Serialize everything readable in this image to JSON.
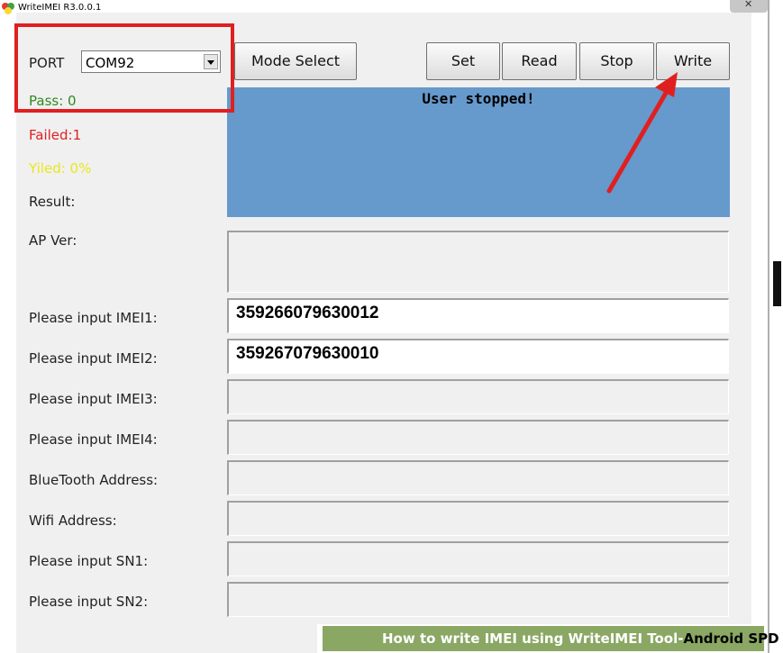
{
  "window": {
    "title": "WriteIMEI R3.0.0.1"
  },
  "port": {
    "label": "PORT",
    "value": "COM92"
  },
  "toolbar": {
    "mode_select": "Mode Select",
    "set": "Set",
    "read": "Read",
    "stop": "Stop",
    "write": "Write"
  },
  "stats": {
    "pass": "Pass:  0",
    "failed": "Failed:1",
    "yield": "Yiled: 0%",
    "result": "Result:"
  },
  "status_message": "User stopped!",
  "fields": [
    {
      "label": "AP Ver:",
      "value": ""
    },
    {
      "label": "Please input IMEI1:",
      "value": "359266079630012"
    },
    {
      "label": "Please input IMEI2:",
      "value": "359267079630010"
    },
    {
      "label": "Please input IMEI3:",
      "value": ""
    },
    {
      "label": "Please input IMEI4:",
      "value": ""
    },
    {
      "label": "BlueTooth Address:",
      "value": ""
    },
    {
      "label": "Wifi Address:",
      "value": ""
    },
    {
      "label": "Please input SN1:",
      "value": ""
    },
    {
      "label": "Please input SN2:",
      "value": ""
    }
  ],
  "banner": {
    "text_prefix": "How to write IMEI using WriteIMEI Tool-",
    "text_highlight": "Android SPD"
  },
  "colors": {
    "pass": "#2e8b22",
    "failed": "#e02020",
    "yield": "#e8e81a",
    "status_bg": "#6699cc",
    "annotation": "#e02020",
    "banner_bg": "#8aa764"
  }
}
